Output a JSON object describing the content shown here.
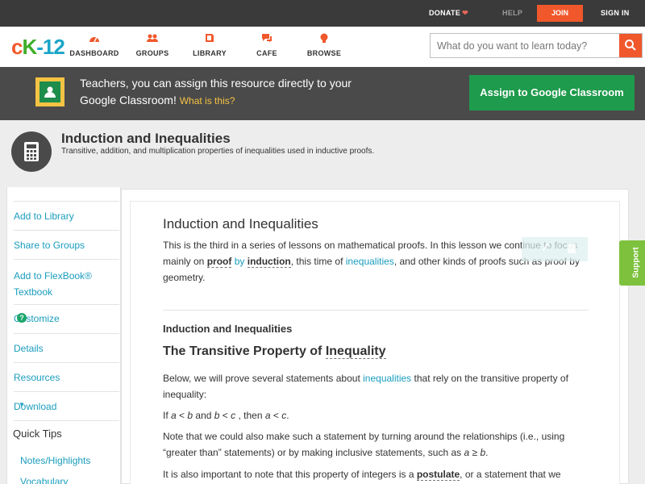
{
  "topbar": {
    "donate": "DONATE",
    "help": "HELP",
    "join": "JOIN",
    "signin": "SIGN IN"
  },
  "logo": {
    "c": "c",
    "k": "K",
    "n": "-12"
  },
  "nav": {
    "items": [
      {
        "label": "DASHBOARD",
        "icon": "dashboard-icon"
      },
      {
        "label": "GROUPS",
        "icon": "groups-icon"
      },
      {
        "label": "LIBRARY",
        "icon": "library-icon"
      },
      {
        "label": "CAFE",
        "icon": "cafe-icon"
      },
      {
        "label": "BROWSE",
        "icon": "browse-icon"
      }
    ]
  },
  "search": {
    "placeholder": "What do you want to learn today?"
  },
  "banner": {
    "text": "Teachers, you can assign this resource directly to your Google Classroom!",
    "what": "What is this?",
    "assign": "Assign to Google Classroom"
  },
  "header": {
    "title": "Induction and Inequalities",
    "subtitle": "Transitive, addition, and multiplication properties of inequalities used in inductive proofs."
  },
  "sidebar": {
    "items": [
      {
        "label": "Add to Library"
      },
      {
        "label": "Share to Groups"
      },
      {
        "label": "Add to FlexBook® Textbook"
      },
      {
        "label": "Customize"
      },
      {
        "label": "Details"
      },
      {
        "label": "Resources"
      },
      {
        "label": "Download"
      }
    ],
    "help_mark": "?",
    "caret": "▼",
    "quick_tips": "Quick Tips",
    "sub": [
      "Notes/Highlights",
      "Vocabulary"
    ]
  },
  "content": {
    "heading": "Induction and Inequalities",
    "intro_1": "This is the third in a series of lessons on mathematical proofs. In this lesson we continue to focus mainly on ",
    "proof": "proof",
    "by": "by",
    "induction": "induction",
    "intro_2": ", this time of ",
    "inequalities": "inequalities",
    "intro_3": ", and other kinds of proofs such as proof by geometry.",
    "section": "Induction and Inequalities",
    "subheading_1": "The Transitive Property of ",
    "subheading_2": "Inequality",
    "p2_1": "Below, we will prove several statements about ",
    "p2_link": "inequalities",
    "p2_2": " that rely on the transitive property of inequality:",
    "p3_if": "If ",
    "p3_a1": "a",
    "p3_lt1": " < ",
    "p3_b1": "b",
    "p3_and": " and ",
    "p3_b2": "b",
    "p3_lt2": " < ",
    "p3_c1": "c",
    "p3_then": " , then ",
    "p3_a2": "a",
    "p3_lt3": " < ",
    "p3_c2": "c",
    "p3_end": ".",
    "p4_1": "Note that we could also make such a statement by turning around the relationships (i.e., using “greater than” statements) or by making inclusive statements, such as ",
    "p4_a": "a",
    "p4_ge": " ≥ ",
    "p4_b": "b",
    "p4_end": ".",
    "p5_1": "It is also important to note that this property of integers is a ",
    "p5_bold": "postulate",
    "p5_2": ", or a statement that we"
  },
  "support": "Support",
  "colors": {
    "accent_orange": "#f0572b",
    "link_teal": "#1a9dbd",
    "google_green": "#1e9b4c",
    "support_green": "#7dc13d"
  }
}
